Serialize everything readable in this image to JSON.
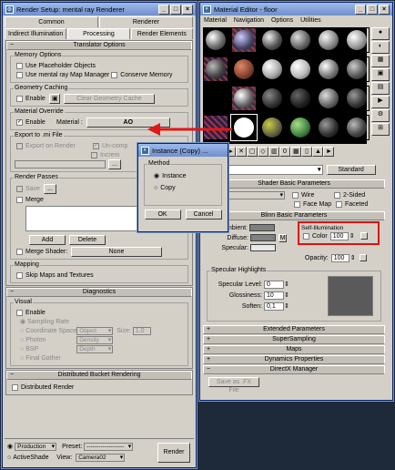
{
  "render_setup": {
    "title": "Render Setup: mental ray Renderer",
    "tabs_row1": [
      "Common",
      "Renderer"
    ],
    "tabs_row2": [
      "Indirect Illumination",
      "Processing",
      "Render Elements"
    ],
    "translator_header": "Translator Options",
    "memory_label": "Memory Options",
    "use_placeholder": "Use Placeholder Objects",
    "use_mr_map": "Use mental ray Map Manager",
    "conserve_memory": "Conserve Memory",
    "geom_caching": "Geometry Caching",
    "enable": "Enable",
    "clear_geom": "Clear Geometry Cache",
    "mat_override": "Material Override",
    "material_label": "Material :",
    "material_value": "AO",
    "export_label": "Export to .mi File",
    "export_render": "Export on Render",
    "uncompressed": "Un-comp",
    "incremental": "Increm",
    "render_passes": "Render Passes",
    "save": "Save",
    "browse": "...",
    "merge": "Merge",
    "add": "Add",
    "delete": "Delete",
    "merge_shader": "Merge Shader:",
    "none": "None",
    "mapping": "Mapping",
    "skip_maps": "Skip Maps and Textures",
    "diagnostics_header": "Diagnostics",
    "visual": "Visual",
    "sampling_rate": "Sampling Rate",
    "coord_space": "Coordinate Space",
    "object": "Object",
    "size": "Size:",
    "size_val": "1,0",
    "photon": "Photon",
    "density": "Density",
    "bsp": "BSP",
    "depth": "Depth",
    "final_gather": "Final Gather",
    "dbr_header": "Distributed Bucket Rendering",
    "distributed_render": "Distributed Render",
    "production": "Production",
    "preset": "Preset:",
    "preset_val": "-------------------",
    "render": "Render",
    "activeshade": "ActiveShade",
    "view": "View:",
    "view_val": "Camera02"
  },
  "material_editor": {
    "title": "Material Editor - floor",
    "menu": [
      "Material",
      "Navigation",
      "Options",
      "Utilities"
    ],
    "material_name": "AO",
    "material_type": "Standard",
    "shader_basic": "Shader Basic Parameters",
    "wire": "Wire",
    "two_sided": "2-Sided",
    "face_map": "Face Map",
    "faceted": "Faceted",
    "blinn_basic": "Blinn Basic Parameters",
    "ambient": "Ambient:",
    "diffuse": "Diffuse:",
    "specular": "Specular:",
    "self_illum": "Self-Illumination",
    "color": "Color",
    "illum_val": "100",
    "opacity": "Opacity:",
    "opacity_val": "100",
    "spec_highlights": "Specular Highlights",
    "spec_level": "Specular Level:",
    "spec_level_val": "0",
    "glossiness": "Glossiness:",
    "gloss_val": "10",
    "soften": "Soften:",
    "soften_val": "0,1",
    "rollouts": [
      "Extended Parameters",
      "SuperSampling",
      "Maps",
      "Dynamics Properties",
      "DirectX Manager"
    ],
    "save_fx": "Save as .FX File",
    "m_label": "M"
  },
  "instance_dialog": {
    "title": "Instance (Copy) ...",
    "method": "Method",
    "instance": "Instance",
    "copy": "Copy",
    "ok": "OK",
    "cancel": "Cancel"
  },
  "colors": {
    "highlight_red": "#e01010",
    "arrow_red": "#e01818"
  }
}
